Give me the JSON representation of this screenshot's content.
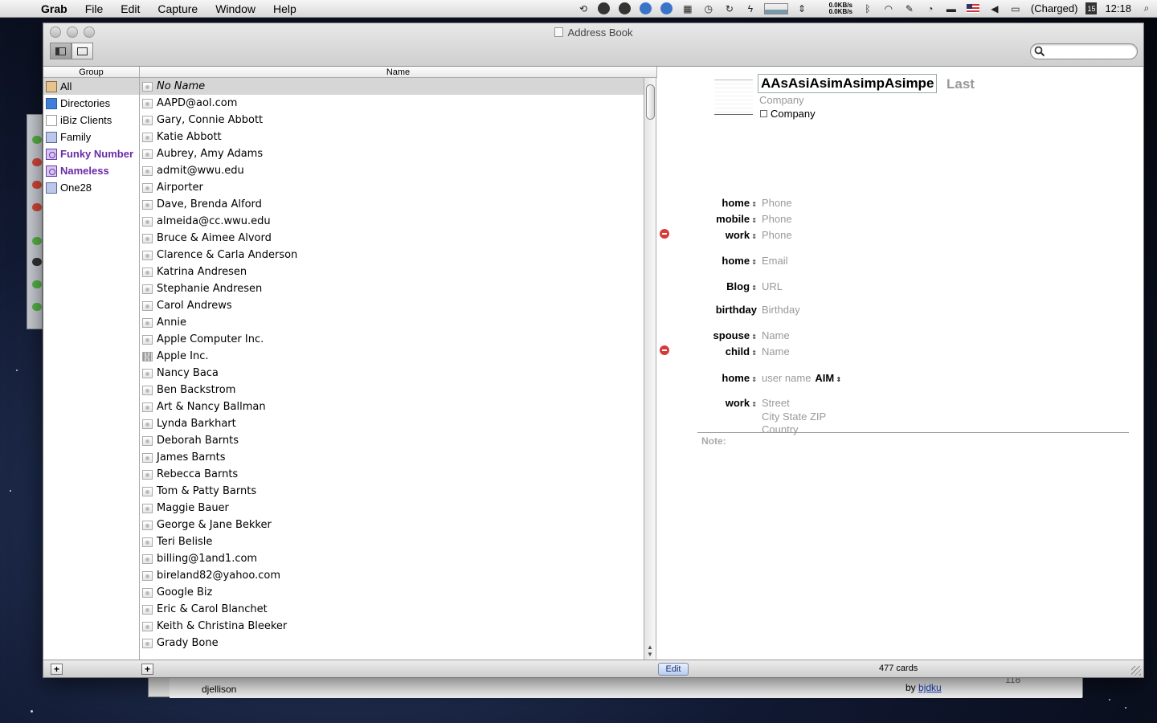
{
  "menubar": {
    "app": "Grab",
    "menus": [
      "File",
      "Edit",
      "Capture",
      "Window",
      "Help"
    ],
    "net_up": "0.0KB/s",
    "net_down": "0.0KB/s",
    "battery": "(Charged)",
    "date_day": "15",
    "clock": "12:18"
  },
  "window": {
    "title": "Address Book"
  },
  "search": {
    "value": "",
    "placeholder": ""
  },
  "columns": {
    "group": "Group",
    "name": "Name"
  },
  "groups": [
    {
      "label": "All",
      "icon": "address-book-icon",
      "selected": true,
      "smart": false
    },
    {
      "label": "Directories",
      "icon": "directory-icon",
      "selected": false,
      "smart": false
    },
    {
      "label": "iBiz Clients",
      "icon": "group-icon",
      "selected": false,
      "smart": false
    },
    {
      "label": "Family",
      "icon": "group-icon",
      "selected": false,
      "smart": false
    },
    {
      "label": "Funky Number",
      "icon": "smart-group-icon",
      "selected": false,
      "smart": true
    },
    {
      "label": "Nameless",
      "icon": "smart-group-icon",
      "selected": false,
      "smart": true
    },
    {
      "label": "One28",
      "icon": "group-icon",
      "selected": false,
      "smart": false
    }
  ],
  "names": [
    {
      "label": "No Name",
      "selected": true,
      "company": false
    },
    {
      "label": "AAPD@aol.com",
      "company": false
    },
    {
      "label": "Gary, Connie Abbott",
      "company": false
    },
    {
      "label": "Katie Abbott",
      "company": false
    },
    {
      "label": "Aubrey, Amy Adams",
      "company": false
    },
    {
      "label": "admit@wwu.edu",
      "company": false
    },
    {
      "label": "Airporter",
      "company": false
    },
    {
      "label": "Dave, Brenda Alford",
      "company": false
    },
    {
      "label": "almeida@cc.wwu.edu",
      "company": false
    },
    {
      "label": "Bruce & Aimee Alvord",
      "company": false
    },
    {
      "label": "Clarence & Carla Anderson",
      "company": false
    },
    {
      "label": "Katrina Andresen",
      "company": false
    },
    {
      "label": "Stephanie Andresen",
      "company": false
    },
    {
      "label": "Carol Andrews",
      "company": false
    },
    {
      "label": "Annie",
      "company": false
    },
    {
      "label": "Apple Computer Inc.",
      "company": false
    },
    {
      "label": "Apple Inc.",
      "company": true
    },
    {
      "label": "Nancy Baca",
      "company": false
    },
    {
      "label": "Ben Backstrom",
      "company": false
    },
    {
      "label": "Art & Nancy Ballman",
      "company": false
    },
    {
      "label": "Lynda Barkhart",
      "company": false
    },
    {
      "label": "Deborah Barnts",
      "company": false
    },
    {
      "label": "James Barnts",
      "company": false
    },
    {
      "label": "Rebecca Barnts",
      "company": false
    },
    {
      "label": "Tom & Patty Barnts",
      "company": false
    },
    {
      "label": "Maggie Bauer",
      "company": false
    },
    {
      "label": "George & Jane Bekker",
      "company": false
    },
    {
      "label": "Teri Belisle",
      "company": false
    },
    {
      "label": "billing@1and1.com",
      "company": false
    },
    {
      "label": "bireland82@yahoo.com",
      "company": false
    },
    {
      "label": "Google Biz",
      "company": false
    },
    {
      "label": "Eric & Carol Blanchet",
      "company": false
    },
    {
      "label": "Keith & Christina Bleeker",
      "company": false
    },
    {
      "label": "Grady Bone",
      "company": false
    }
  ],
  "card": {
    "first": "AAsAsiAsimAsimpAsimpe",
    "last": "Last",
    "company_placeholder": "Company",
    "company_checkbox": "Company",
    "fields": [
      {
        "label": "home",
        "value": "Phone"
      },
      {
        "label": "mobile",
        "value": "Phone"
      },
      {
        "label": "work",
        "value": "Phone"
      },
      {
        "label": "home",
        "value": "Email"
      },
      {
        "label": "Blog",
        "value": "URL"
      },
      {
        "label": "birthday",
        "value": "Birthday"
      },
      {
        "label": "spouse",
        "value": "Name"
      },
      {
        "label": "child",
        "value": "Name"
      },
      {
        "label": "home",
        "value": "user name",
        "service": "AIM"
      },
      {
        "label": "work",
        "value": "Street",
        "line2": "City  State  ZIP",
        "line3": "Country"
      }
    ],
    "note_label": "Note:"
  },
  "bottom": {
    "add": "+",
    "edit": "Edit",
    "count": "477 cards"
  },
  "behind": {
    "user": "djellison",
    "by": "by",
    "by_user": "bjdku",
    "num": "118"
  }
}
